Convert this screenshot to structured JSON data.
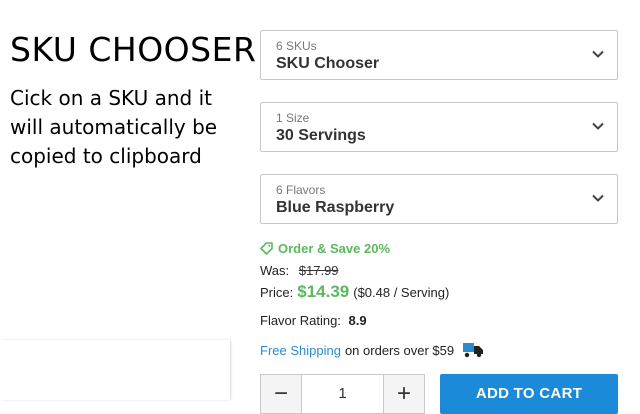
{
  "left": {
    "title": "SKU CHOOSER",
    "instructions": "Cick on a SKU and it will automatically be copied to clipboard"
  },
  "selects": [
    {
      "count": "6 SKUs",
      "value": "SKU Chooser"
    },
    {
      "count": "1 Size",
      "value": "30 Servings"
    },
    {
      "count": "6 Flavors",
      "value": "Blue Raspberry"
    }
  ],
  "promo": {
    "text": "Order & Save 20%",
    "icon": "tag-icon"
  },
  "pricing": {
    "was_label": "Was:",
    "was_price": "$17.99",
    "price_label": "Price:",
    "price": "$14.39",
    "per_serving": "($0.48 / Serving)"
  },
  "rating": {
    "label": "Flavor Rating:",
    "value": "8.9"
  },
  "shipping": {
    "link": "Free Shipping",
    "text": "on orders over $59",
    "icon": "truck-icon"
  },
  "cart": {
    "minus": "−",
    "quantity": "1",
    "plus": "+",
    "add_label": "ADD TO CART"
  },
  "colors": {
    "accent_green": "#5cb85c",
    "link_blue": "#2a8bd1",
    "button_blue": "#1a8ad9"
  }
}
